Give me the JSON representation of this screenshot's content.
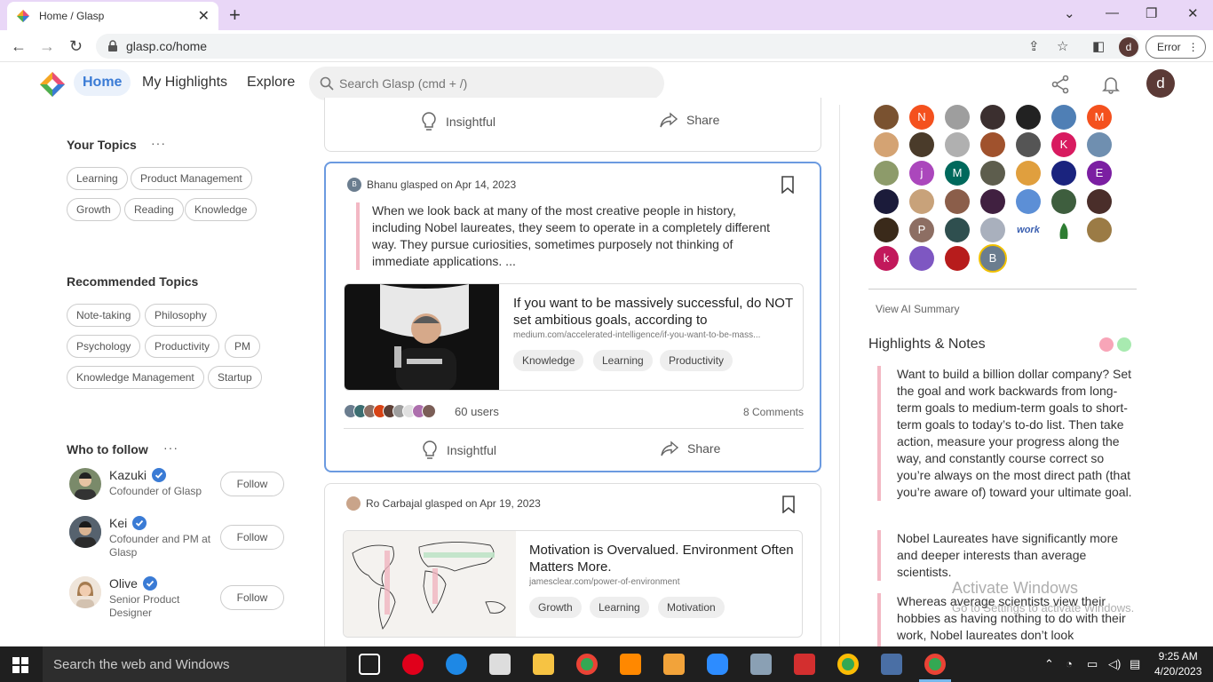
{
  "browser": {
    "tab_title": "Home / Glasp",
    "url": "glasp.co/home",
    "profile_initial": "d",
    "error_label": "Error"
  },
  "header": {
    "nav": [
      "Home",
      "My Highlights",
      "Explore"
    ],
    "search_placeholder": "Search Glasp (cmd + /)",
    "avatar_initial": "d"
  },
  "sidebar": {
    "your_topics_title": "Your Topics",
    "your_topics": [
      "Learning",
      "Product Management",
      "Growth",
      "Reading",
      "Knowledge"
    ],
    "recommended_title": "Recommended Topics",
    "recommended": [
      "Note-taking",
      "Philosophy",
      "Psychology",
      "Productivity",
      "PM",
      "Knowledge Management",
      "Startup"
    ],
    "who_to_follow_title": "Who to follow",
    "more": "···",
    "follow_label": "Follow",
    "people": [
      {
        "name": "Kazuki",
        "role": "Cofounder of Glasp"
      },
      {
        "name": "Kei",
        "role": "Cofounder and PM at Glasp"
      },
      {
        "name": "Olive",
        "role": "Senior Product Designer"
      }
    ]
  },
  "feed": {
    "insightful": "Insightful",
    "share": "Share",
    "cards": [
      {
        "user": "Bhanu",
        "user_initial": "B",
        "glasped_on": "glasped on Apr 14, 2023",
        "quote": "When we look back at many of the most creative people in history, including Nobel laureates, they seem to operate in a completely different way. They pursue curiosities, sometimes purposely not thinking of immediate applications. ...",
        "title": "If you want to be massively successful, do NOT set ambitious goals, according to",
        "url": "medium.com/accelerated-intelligence/if-you-want-to-be-mass...",
        "tags": [
          "Knowledge",
          "Learning",
          "Productivity"
        ],
        "users": "60 users",
        "comments": "8 Comments"
      },
      {
        "user": "Ro Carbajal",
        "glasped_on": "glasped on Apr 19, 2023",
        "title": "Motivation is Overvalued. Environment Often Matters More.",
        "url": "jamesclear.com/power-of-environment",
        "tags": [
          "Growth",
          "Learning",
          "Motivation"
        ]
      }
    ]
  },
  "right": {
    "grid_letters": [
      "N",
      "M",
      "K",
      "j",
      "M",
      "E",
      "P",
      "work",
      "k",
      "B"
    ],
    "ai_summary": "View AI Summary",
    "highlights_title": "Highlights & Notes",
    "notes": [
      "Want to build a billion dollar company? Set the goal and work backwards from long-term goals to medium-term goals to short-term goals to today’s to-do list. Then take action, measure your progress along the way, and constantly course correct so you’re always on the most direct path (that you’re aware of) toward your ultimate goal.",
      "Nobel Laureates have significantly more and deeper interests than average scientists.",
      "Whereas average scientists view their hobbies as having nothing to do with their work, Nobel laureates don’t look"
    ]
  },
  "watermark": {
    "line1": "Activate Windows",
    "line2": "Go to Settings to activate Windows."
  },
  "taskbar": {
    "search": "Search the web and Windows",
    "time": "9:25 AM",
    "date": "4/20/2023"
  },
  "colors": {
    "accent": "#3a7bd5",
    "quote_bar": "#f3b8c4",
    "tab_strip": "#e9d7f7"
  }
}
